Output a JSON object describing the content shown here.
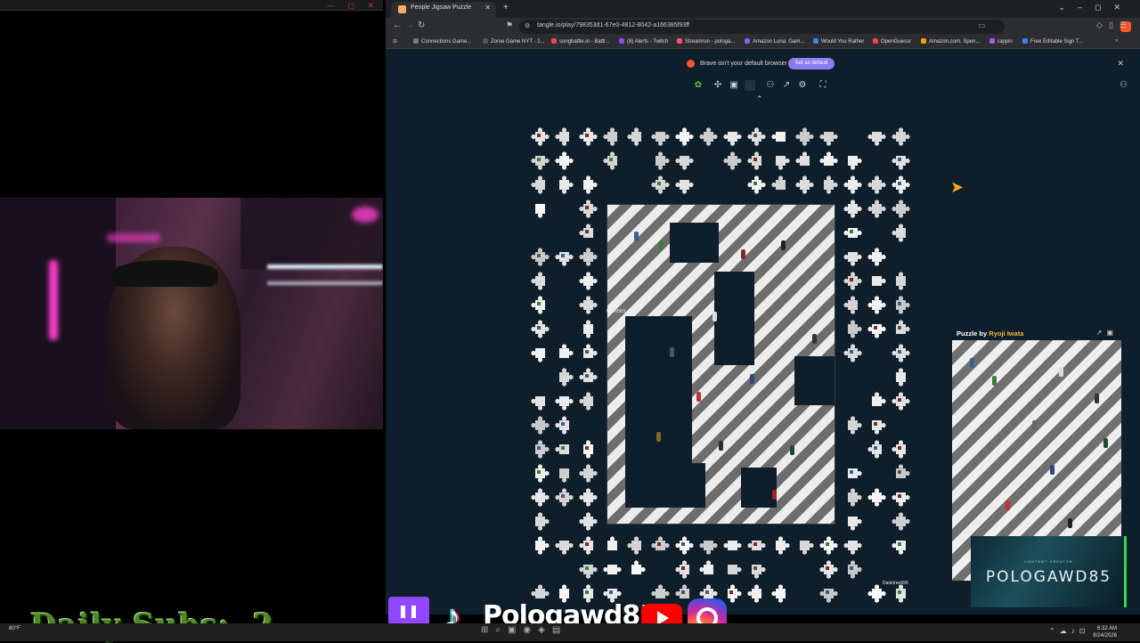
{
  "overlay": {
    "daily_subs_label": "Daily Subs:",
    "daily_subs_count": "2",
    "social_handle": "Pologawd85",
    "brand_name": "POLOGAWD85",
    "brand_tagline": "CONTENT CREATOR"
  },
  "browser": {
    "tab_title": "People Jigsaw Puzzle",
    "url": "tangle.io/play/798353d1-67e0-4812-8042-a166385f93ff",
    "bookmarks": [
      "Connections Game...",
      "Zorse Game NYT - 1...",
      "songbattle.io - Battl...",
      "(8) Alerts - Twitch",
      "Streamrun - pologa...",
      "Amazon Luna: Gam...",
      "Would You Rather",
      "OpenGuessr",
      "Amazon.com. Spen...",
      "rappin",
      "Free Editable Sign T..."
    ],
    "bookmark_colors": [
      "#7a7a7a",
      "#222222",
      "#e94b4b",
      "#9146ff",
      "#ff4d7a",
      "#8a5cf6",
      "#3b82f6",
      "#ef4444",
      "#f59e0b",
      "#a855f7",
      "#3b82f6"
    ],
    "infobar_text": "Brave isn't your default browser",
    "infobar_button": "Set as default"
  },
  "puzzle": {
    "preview_label_prefix": "Puzzle by",
    "preview_author": "Ryoji Iwata",
    "cursor_users": [
      "Hated901",
      "Danktree999"
    ]
  },
  "taskbar": {
    "weather": "80°F",
    "time": "6:32 AM",
    "date": "8/24/2026"
  },
  "colors": {
    "accent": "#8d7bf2",
    "canvas_bg": "#0f1e2b",
    "subs_green": "#4d8a24"
  }
}
